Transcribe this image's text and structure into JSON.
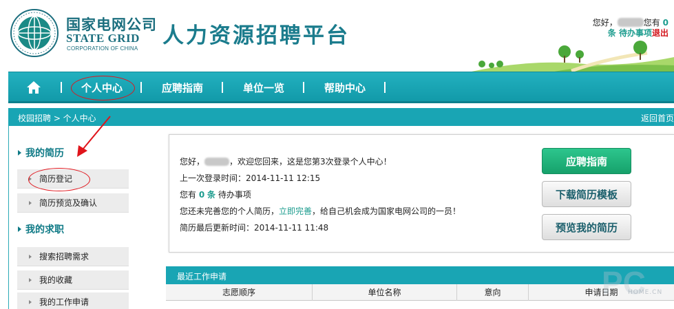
{
  "header": {
    "logo_cn": "国家电网公司",
    "logo_en": "STATE GRID",
    "logo_en_sub": "CORPORATION OF CHINA",
    "platform_title": "人力资源招聘平台",
    "user": {
      "greeting": "您好，",
      "you_have": "您有",
      "pending_count": "0",
      "pending_text": "条 待办事项",
      "logout": "退出"
    }
  },
  "nav": {
    "home_icon": "home-icon",
    "items": [
      "个人中心",
      "应聘指南",
      "单位一览",
      "帮助中心"
    ]
  },
  "breadcrumb": {
    "path": "校园招聘 > 个人中心",
    "back_home": "返回首页"
  },
  "sidebar": {
    "sections": [
      {
        "title": "我的简历",
        "items": [
          "简历登记",
          "简历预览及确认"
        ]
      },
      {
        "title": "我的求职",
        "items": [
          "搜索招聘需求",
          "我的收藏",
          "我的工作申请"
        ]
      }
    ]
  },
  "welcome": {
    "line1_prefix": "您好，",
    "line1_suffix": "，欢迎您回来，这是您第3次登录个人中心！",
    "line2": "上一次登录时间：2014-11-11 12:15",
    "line3_prefix": "您有",
    "line3_count": "0",
    "line3_count_unit": "条",
    "line3_suffix": "待办事项",
    "line4_prefix": "您还未完善您的个人简历，",
    "line4_link": "立即完善",
    "line4_suffix": "，给自己机会成为国家电网公司的一员！",
    "line5": "简历最后更新时间：2014-11-11 11:48",
    "buttons": [
      "应聘指南",
      "下载简历模板",
      "预览我的简历"
    ]
  },
  "applications": {
    "title": "最近工作申请",
    "columns": [
      "志愿顺序",
      "单位名称",
      "意向",
      "申请日期"
    ]
  },
  "watermark": {
    "text": "PC",
    "subtext": "HOME.CN"
  },
  "colors": {
    "teal": "#19a5b4",
    "accent_green": "#1c9c8e",
    "logout_red": "#d3141b",
    "annotation_red": "#e0141b"
  }
}
